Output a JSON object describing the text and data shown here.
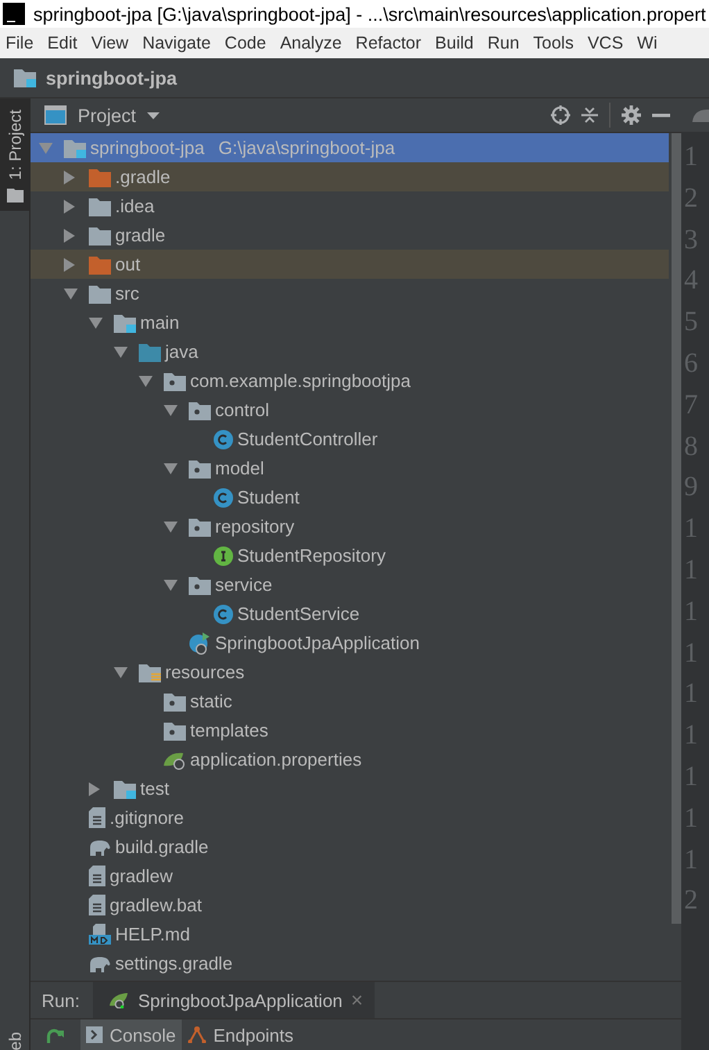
{
  "window": {
    "title": "springboot-jpa [G:\\java\\springboot-jpa] - ...\\src\\main\\resources\\application.propert"
  },
  "menu": [
    "File",
    "Edit",
    "View",
    "Navigate",
    "Code",
    "Analyze",
    "Refactor",
    "Build",
    "Run",
    "Tools",
    "VCS",
    "Wi"
  ],
  "navigation_bar": {
    "module": "springboot-jpa"
  },
  "left_tool_strip": [
    {
      "label": "1: Project",
      "selected": true
    },
    {
      "label": "eb",
      "selected": false
    }
  ],
  "project_panel": {
    "title": "Project",
    "tree": [
      {
        "name": "springboot-jpa",
        "location": "G:\\java\\springboot-jpa",
        "kind": "module",
        "selected": true,
        "excluded": false,
        "expanded": true,
        "children": [
          {
            "name": ".gradle",
            "kind": "folder",
            "selected": false,
            "excluded": true,
            "expanded": false
          },
          {
            "name": ".idea",
            "kind": "folder",
            "selected": false,
            "excluded": false,
            "expanded": false
          },
          {
            "name": "gradle",
            "kind": "folder",
            "selected": false,
            "excluded": false,
            "expanded": false
          },
          {
            "name": "out",
            "kind": "folder",
            "selected": false,
            "excluded": true,
            "expanded": false
          },
          {
            "name": "src",
            "kind": "folder",
            "selected": false,
            "excluded": false,
            "expanded": true,
            "children": [
              {
                "name": "main",
                "kind": "module-folder",
                "selected": false,
                "excluded": false,
                "expanded": true,
                "children": [
                  {
                    "name": "java",
                    "kind": "source-root",
                    "selected": false,
                    "excluded": false,
                    "expanded": true,
                    "children": [
                      {
                        "name": "com.example.springbootjpa",
                        "kind": "package",
                        "selected": false,
                        "excluded": false,
                        "expanded": true,
                        "children": [
                          {
                            "name": "control",
                            "kind": "package",
                            "selected": false,
                            "excluded": false,
                            "expanded": true,
                            "children": [
                              {
                                "name": "StudentController",
                                "kind": "class",
                                "selected": false,
                                "excluded": false
                              }
                            ]
                          },
                          {
                            "name": "model",
                            "kind": "package",
                            "selected": false,
                            "excluded": false,
                            "expanded": true,
                            "children": [
                              {
                                "name": "Student",
                                "kind": "class",
                                "selected": false,
                                "excluded": false
                              }
                            ]
                          },
                          {
                            "name": "repository",
                            "kind": "package",
                            "selected": false,
                            "excluded": false,
                            "expanded": true,
                            "children": [
                              {
                                "name": "StudentRepository",
                                "kind": "interface",
                                "selected": false,
                                "excluded": false
                              }
                            ]
                          },
                          {
                            "name": "service",
                            "kind": "package",
                            "selected": false,
                            "excluded": false,
                            "expanded": true,
                            "children": [
                              {
                                "name": "StudentService",
                                "kind": "class",
                                "selected": false,
                                "excluded": false
                              }
                            ]
                          },
                          {
                            "name": "SpringbootJpaApplication",
                            "kind": "boot-class",
                            "selected": false,
                            "excluded": false
                          }
                        ]
                      }
                    ]
                  },
                  {
                    "name": "resources",
                    "kind": "resources-root",
                    "selected": false,
                    "excluded": false,
                    "expanded": true,
                    "children": [
                      {
                        "name": "static",
                        "kind": "package",
                        "selected": false,
                        "excluded": false
                      },
                      {
                        "name": "templates",
                        "kind": "package",
                        "selected": false,
                        "excluded": false
                      },
                      {
                        "name": "application.properties",
                        "kind": "spring-config",
                        "selected": false,
                        "excluded": false
                      }
                    ]
                  }
                ]
              },
              {
                "name": "test",
                "kind": "module-folder",
                "selected": false,
                "excluded": false,
                "expanded": false
              }
            ]
          },
          {
            "name": ".gitignore",
            "kind": "text-file",
            "selected": false,
            "excluded": false
          },
          {
            "name": "build.gradle",
            "kind": "gradle",
            "selected": false,
            "excluded": false
          },
          {
            "name": "gradlew",
            "kind": "text-file",
            "selected": false,
            "excluded": false
          },
          {
            "name": "gradlew.bat",
            "kind": "text-file",
            "selected": false,
            "excluded": false
          },
          {
            "name": "HELP.md",
            "kind": "markdown",
            "selected": false,
            "excluded": false
          },
          {
            "name": "settings.gradle",
            "kind": "gradle",
            "selected": false,
            "excluded": false
          }
        ]
      }
    ]
  },
  "editor_gutter": {
    "line_numbers": [
      "1",
      "2",
      "3",
      "4",
      "5",
      "6",
      "7",
      "8",
      "9",
      "1",
      "1",
      "1",
      "1",
      "1",
      "1",
      "1",
      "1",
      "1",
      "2"
    ]
  },
  "run_panel": {
    "label": "Run:",
    "tab": "SpringbootJpaApplication",
    "close": "×",
    "tabs": [
      {
        "label": "Console",
        "selected": true
      },
      {
        "label": "Endpoints",
        "selected": false
      }
    ]
  }
}
